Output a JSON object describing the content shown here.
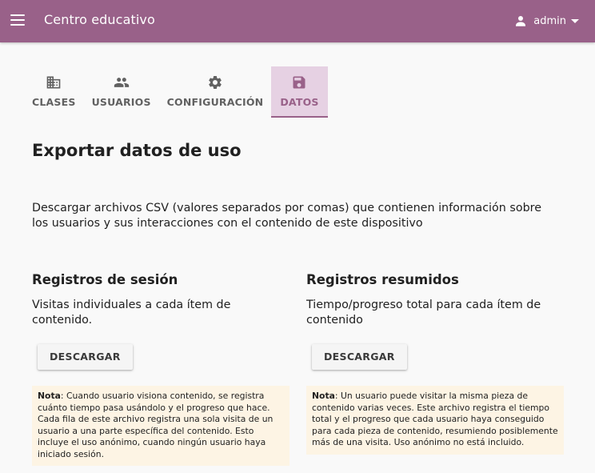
{
  "colors": {
    "brand": "#996189",
    "tab_active_bg": "#e6d1e3",
    "note_bg": "#fdf4e4",
    "page_bg": "#f9f9f9"
  },
  "appbar": {
    "menu_icon": "menu-icon",
    "title": "Centro educativo",
    "user": {
      "icon": "person-icon",
      "name": "admin"
    }
  },
  "tabs": [
    {
      "label": "CLASES",
      "icon": "classroom-icon",
      "active": false
    },
    {
      "label": "USUARIOS",
      "icon": "people-icon",
      "active": false
    },
    {
      "label": "CONFIGURACIÓN",
      "icon": "gear-icon",
      "active": false
    },
    {
      "label": "DATOS",
      "icon": "save-icon",
      "active": true
    }
  ],
  "page": {
    "title": "Exportar datos de uso",
    "description": "Descargar archivos CSV (valores separados por comas) que contienen información sobre los usuarios y sus interacciones con el contenido de este dispositivo"
  },
  "session_logs": {
    "heading": "Registros de sesión",
    "subtitle": "Visitas individuales a cada ítem de contenido.",
    "button": "DESCARGAR",
    "note_label": "Nota",
    "note_text": ": Cuando usuario visiona contenido, se registra cuánto tiempo pasa usándolo y el progreso que hace. Cada fila de este archivo registra una sola visita de un usuario a una parte específica del contenido. Esto incluye el uso anónimo, cuando ningún usuario haya iniciado sesión."
  },
  "summary_logs": {
    "heading": "Registros resumidos",
    "subtitle": "Tiempo/progreso total para cada ítem de contenido",
    "button": "DESCARGAR",
    "note_label": "Nota",
    "note_text": ": Un usuario puede visitar la misma pieza de contenido varias veces. Este archivo registra el tiempo total y el progreso que cada usuario haya conseguido para cada pieza de contenido, resumiendo posiblemente más de una visita. Uso anónimo no está incluido."
  }
}
